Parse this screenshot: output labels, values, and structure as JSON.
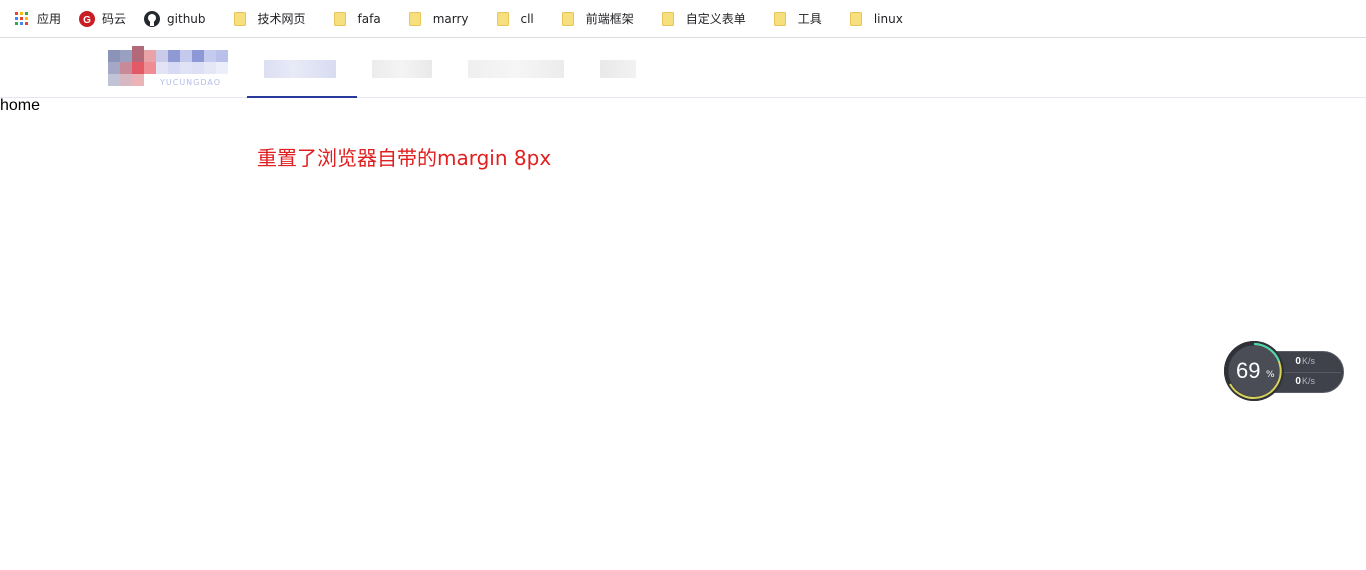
{
  "bookmarks": [
    {
      "label": "应用",
      "icon": "apps-grid-icon",
      "kind": "apps"
    },
    {
      "label": "码云",
      "icon": "gitee-icon",
      "kind": "gitee"
    },
    {
      "label": "github",
      "icon": "github-icon",
      "kind": "github"
    },
    {
      "label": "技术网页",
      "icon": "folder-icon",
      "kind": "folder"
    },
    {
      "label": "fafa",
      "icon": "folder-icon",
      "kind": "folder"
    },
    {
      "label": "marry",
      "icon": "folder-icon",
      "kind": "folder"
    },
    {
      "label": "cll",
      "icon": "folder-icon",
      "kind": "folder"
    },
    {
      "label": "前端框架",
      "icon": "folder-icon",
      "kind": "folder"
    },
    {
      "label": "自定义表单",
      "icon": "folder-icon",
      "kind": "folder"
    },
    {
      "label": "工具",
      "icon": "folder-icon",
      "kind": "folder"
    },
    {
      "label": "linux",
      "icon": "folder-icon",
      "kind": "folder"
    }
  ],
  "header": {
    "logo_sub": "YUCUNGDAO",
    "active_tab_color": "#2a3a9a"
  },
  "content": {
    "home_text": "home",
    "note_text": "重置了浏览器自带的margin 8px",
    "note_color": "#e02020"
  },
  "net_widget": {
    "percent": "69",
    "percent_symbol": "%",
    "upload_value": "0",
    "upload_unit": "K/s",
    "download_value": "0",
    "download_unit": "K/s"
  }
}
